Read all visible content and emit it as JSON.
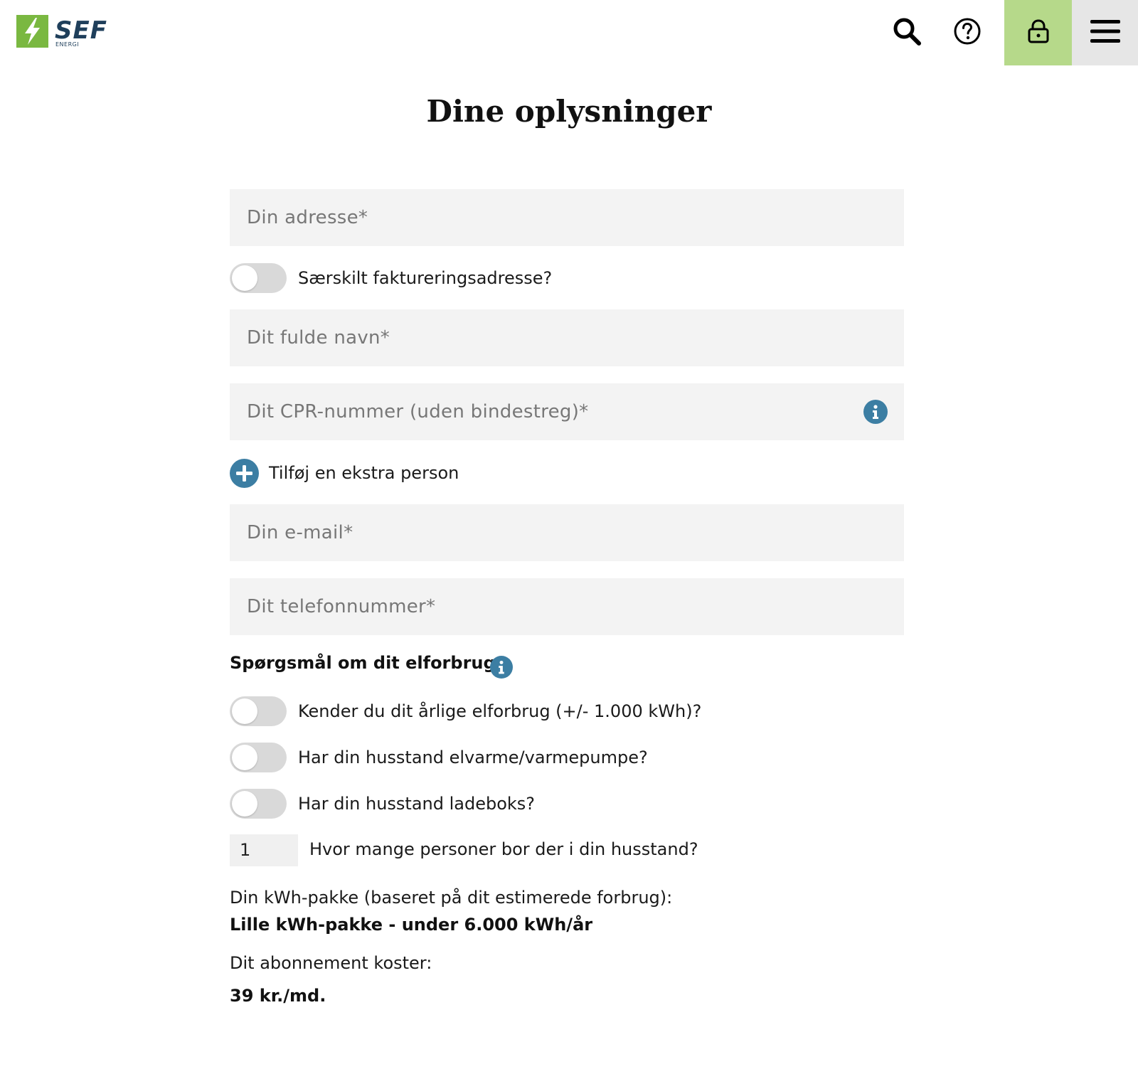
{
  "header": {
    "logo_text": "SEF",
    "logo_sub": "ENERGI",
    "accent": "#7ab841",
    "brand_color": "#1f3f5b",
    "icons": [
      "search-icon",
      "help-icon",
      "lock-icon",
      "menu-icon"
    ]
  },
  "page": {
    "title": "Dine oplysninger"
  },
  "form": {
    "address_placeholder": "Din adresse*",
    "billing_toggle_label": "Særskilt faktureringsadresse?",
    "name_placeholder": "Dit fulde navn*",
    "cpr_placeholder": "Dit CPR-nummer (uden bindestreg)*",
    "add_person_label": "Tilføj en ekstra person",
    "email_placeholder": "Din e-mail*",
    "phone_placeholder": "Dit telefonnummer*"
  },
  "usage": {
    "section_title": "Spørgsmål om dit elforbrug:",
    "q_known_usage": "Kender du dit årlige elforbrug (+/- 1.000 kWh)?",
    "q_heat_pump": "Har din husstand elvarme/varmepumpe?",
    "q_charger": "Har din husstand ladeboks?",
    "persons_value": "1",
    "persons_label": "Hvor mange personer bor der i din husstand?"
  },
  "summary": {
    "package_label": "Din kWh-pakke (baseret på dit estimerede forbrug):",
    "package_value": "Lille kWh-pakke - under 6.000 kWh/år",
    "price_label": "Dit abonnement koster:",
    "price_value": "39 kr./md."
  },
  "colors": {
    "info_blue": "#3c7ea3",
    "field_bg": "#f3f3f3",
    "lock_bg": "#b6d98a"
  }
}
